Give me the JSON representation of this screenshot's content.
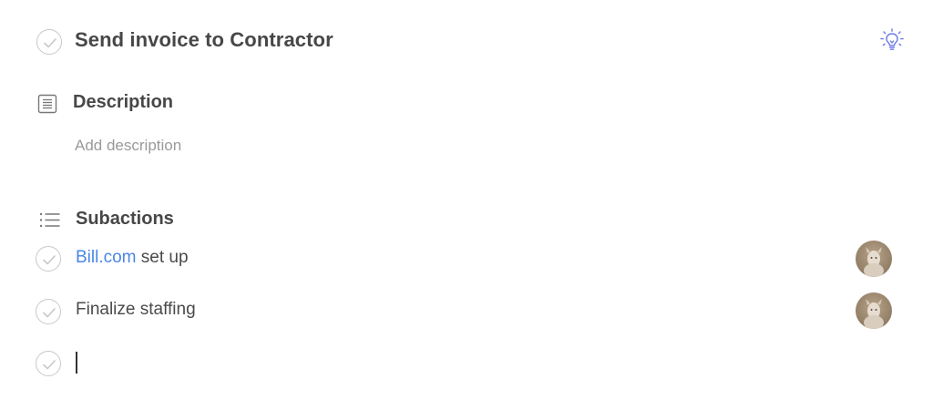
{
  "task": {
    "title": "Send invoice to Contractor",
    "tip_icon": "lightbulb-icon",
    "accent_color": "#6b7ae8"
  },
  "description": {
    "heading": "Description",
    "icon": "document-lines-icon",
    "placeholder": "Add description"
  },
  "subactions": {
    "heading": "Subactions",
    "icon": "list-icon",
    "items": [
      {
        "link_text": "Bill.com",
        "text": " set up",
        "avatar": "assignee-avatar"
      },
      {
        "link_text": "",
        "text": "Finalize staffing",
        "avatar": "assignee-avatar"
      }
    ],
    "new_item_value": ""
  },
  "colors": {
    "link": "#4a86e8",
    "check_border": "#c8c8c8"
  }
}
